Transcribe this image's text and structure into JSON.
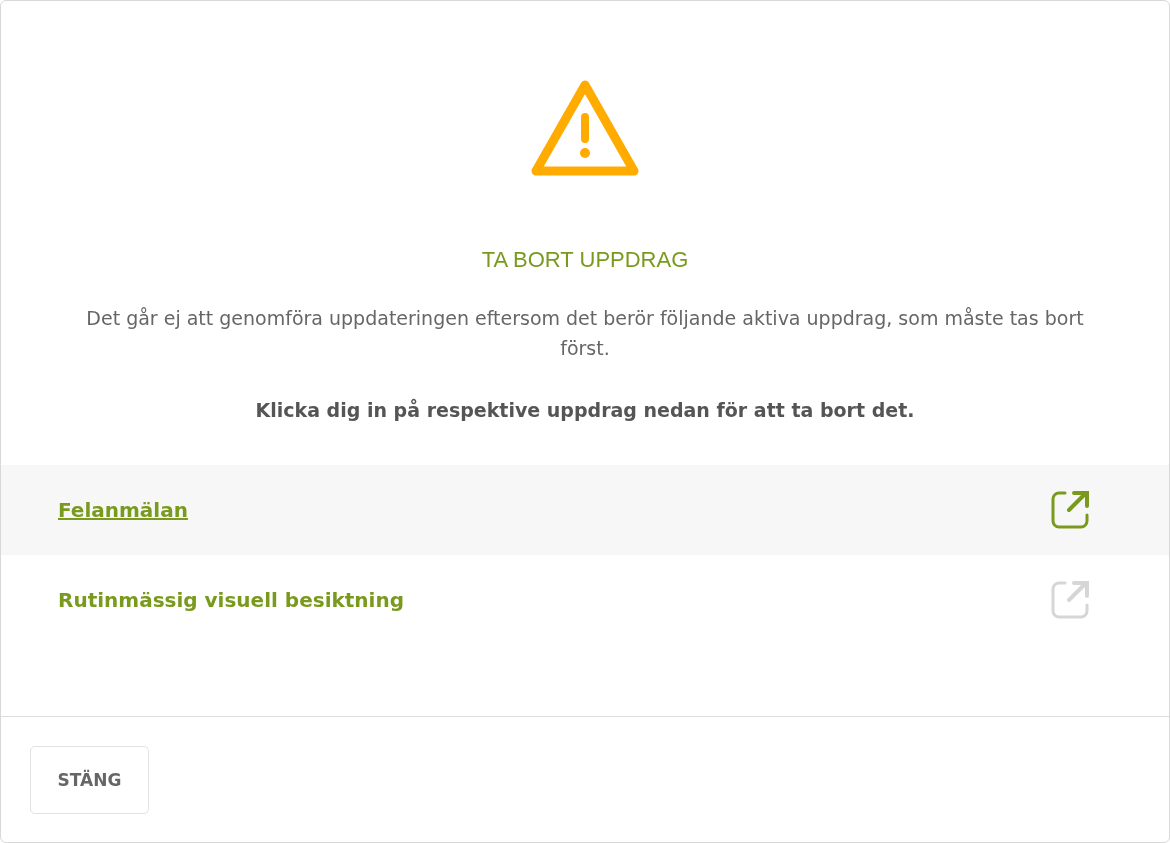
{
  "dialog": {
    "title": "TA BORT UPPDRAG",
    "message": "Det går ej att genomföra uppdateringen eftersom det berör följande aktiva uppdrag, som måste tas bort först.",
    "instruction": "Klicka dig in på respektive uppdrag nedan för att ta bort det.",
    "items": [
      {
        "label": "Felanmälan",
        "hovered": true
      },
      {
        "label": "Rutinmässig visuell besiktning",
        "hovered": false
      }
    ],
    "buttons": [
      {
        "label": "STÄNG"
      }
    ]
  }
}
